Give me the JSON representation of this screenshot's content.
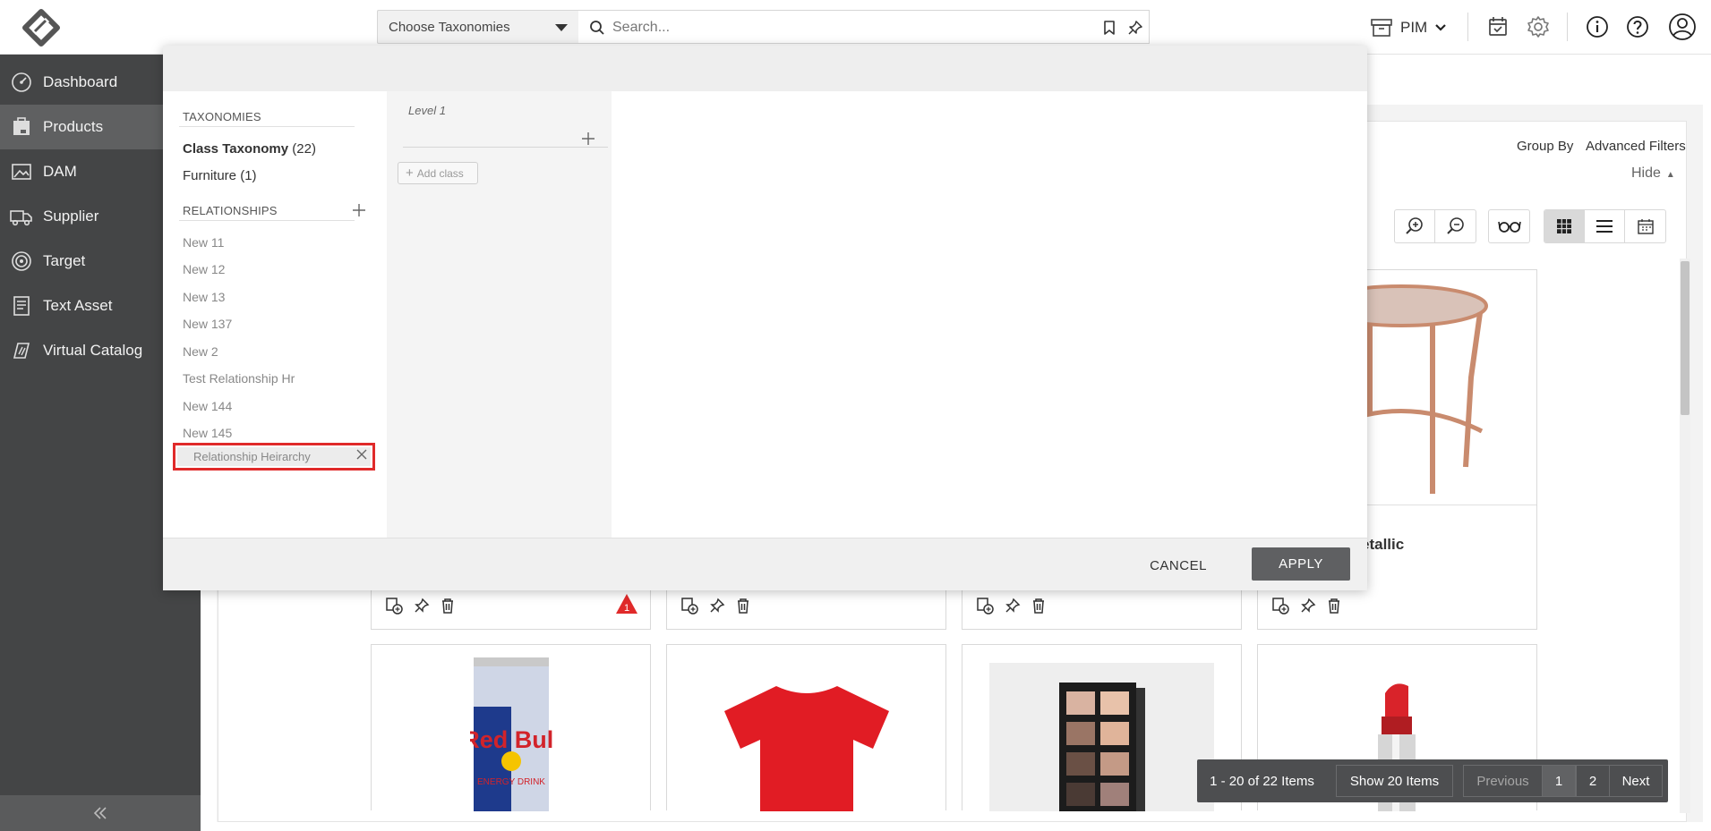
{
  "topbar": {
    "taxonomy_select": "Choose Taxonomies",
    "search_placeholder": "Search...",
    "module": "PIM"
  },
  "sidebar": {
    "items": [
      {
        "label": "Dashboard",
        "icon": "gauge-icon"
      },
      {
        "label": "Products",
        "icon": "box-icon",
        "active": true
      },
      {
        "label": "DAM",
        "icon": "image-icon"
      },
      {
        "label": "Supplier",
        "icon": "truck-icon"
      },
      {
        "label": "Target",
        "icon": "target-icon"
      },
      {
        "label": "Text Asset",
        "icon": "document-icon"
      },
      {
        "label": "Virtual Catalog",
        "icon": "catalog-icon"
      }
    ]
  },
  "content": {
    "group_by": "Group By",
    "advanced_filters": "Advanced Filters",
    "hide": "Hide",
    "card_partial_title": "etallic",
    "pager": {
      "range": "1 - 20 of 22 Items",
      "show": "Show 20 Items",
      "previous": "Previous",
      "page1": "1",
      "page2": "2",
      "next": "Next"
    },
    "warning_count": "1"
  },
  "modal": {
    "taxonomies_heading": "TAXONOMIES",
    "taxonomies": [
      {
        "name": "Class Taxonomy",
        "count": "(22)",
        "bold": true
      },
      {
        "name": "Furniture",
        "count": "(1)",
        "bold": false
      }
    ],
    "relationships_heading": "RELATIONSHIPS",
    "relationships": [
      "New 11",
      "New 12",
      "New 13",
      "New 137",
      "New 2",
      "Test Relationship Hr",
      "New 144",
      "New 145"
    ],
    "selected_relationship": "Relationship Heirarchy",
    "level_label": "Level 1",
    "add_class": "Add class",
    "cancel": "CANCEL",
    "apply": "APPLY"
  },
  "colors": {
    "sidebar": "#444546",
    "sidebar_active": "#5f6061",
    "apply_button": "#5f6062",
    "highlight_border": "#e02a2a",
    "warning": "#e02a2a"
  }
}
